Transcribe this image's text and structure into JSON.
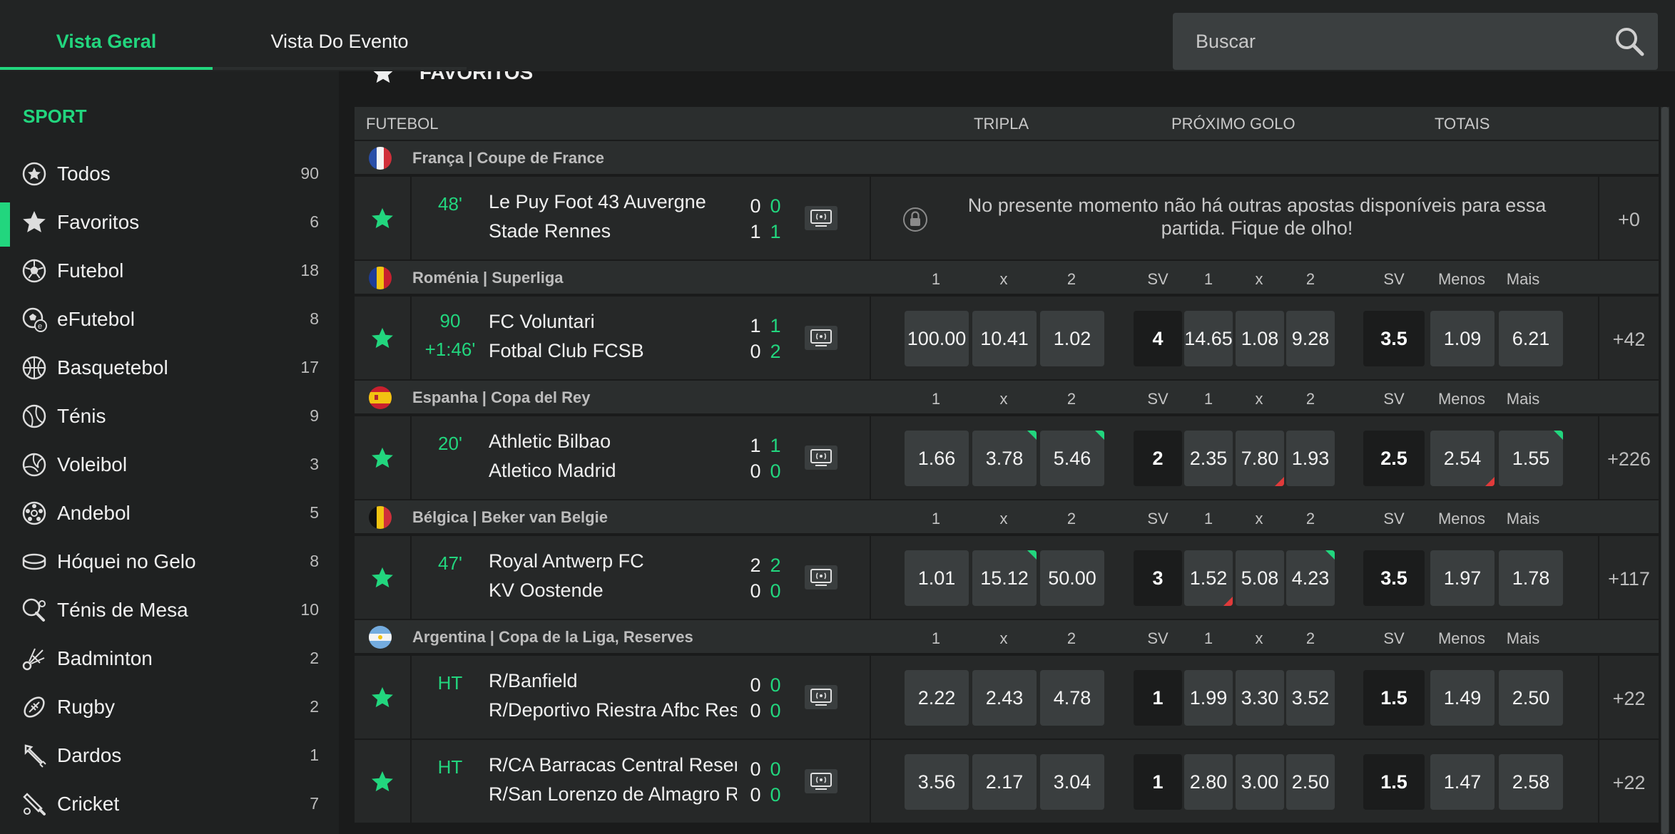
{
  "header": {
    "tabs": [
      {
        "label": "Vista Geral"
      },
      {
        "label": "Vista Do Evento"
      }
    ],
    "search_placeholder": "Buscar"
  },
  "sidebar": {
    "title": "SPORT",
    "items": [
      {
        "label": "Todos",
        "count": "90",
        "icon": "all-sports-icon"
      },
      {
        "label": "Favoritos",
        "count": "6",
        "icon": "star-icon"
      },
      {
        "label": "Futebol",
        "count": "18",
        "icon": "soccer-ball-icon"
      },
      {
        "label": "eFutebol",
        "count": "8",
        "icon": "esoccer-icon"
      },
      {
        "label": "Basquetebol",
        "count": "17",
        "icon": "basketball-icon"
      },
      {
        "label": "Ténis",
        "count": "9",
        "icon": "tennis-ball-icon"
      },
      {
        "label": "Voleibol",
        "count": "3",
        "icon": "volleyball-icon"
      },
      {
        "label": "Andebol",
        "count": "5",
        "icon": "handball-icon"
      },
      {
        "label": "Hóquei no Gelo",
        "count": "8",
        "icon": "ice-hockey-puck-icon"
      },
      {
        "label": "Ténis de Mesa",
        "count": "10",
        "icon": "table-tennis-icon"
      },
      {
        "label": "Badminton",
        "count": "2",
        "icon": "shuttlecock-icon"
      },
      {
        "label": "Rugby",
        "count": "2",
        "icon": "rugby-ball-icon"
      },
      {
        "label": "Dardos",
        "count": "1",
        "icon": "darts-icon"
      },
      {
        "label": "Cricket",
        "count": "7",
        "icon": "cricket-bat-icon"
      }
    ]
  },
  "favorites_header": "FAVORITOS",
  "columns": {
    "sport": "FUTEBOL",
    "tripla": "TRIPLA",
    "proximo": "PRÓXIMO GOLO",
    "totais": "TOTAIS"
  },
  "market_labels": {
    "one": "1",
    "x": "x",
    "two": "2",
    "sv": "SV",
    "menos": "Menos",
    "mais": "Mais"
  },
  "leagues": [
    {
      "name": "França | Coupe de France"
    },
    {
      "name": "Roménia | Superliga"
    },
    {
      "name": "Espanha | Copa del Rey"
    },
    {
      "name": "Bélgica | Beker van Belgie"
    },
    {
      "name": "Argentina | Copa de la Liga, Reserves"
    }
  ],
  "matches": [
    {
      "time": "48'",
      "time2": "",
      "home": "Le Puy Foot 43 Auvergne",
      "away": "Stade Rennes",
      "h1": "0",
      "h2": "0",
      "a1": "1",
      "a2": "1",
      "more": "+0",
      "no_bets": "No presente momento não há outras apostas disponíveis para essa partida. Fique de olho!"
    },
    {
      "time": "90",
      "time2": "+1:46'",
      "home": "FC Voluntari",
      "away": "Fotbal Club FCSB",
      "h1": "1",
      "h2": "1",
      "a1": "0",
      "a2": "2",
      "more": "+42",
      "tripla": [
        "100.00",
        "10.41",
        "1.02"
      ],
      "ng_sv": "4",
      "ng": [
        "14.65",
        "1.08",
        "9.28"
      ],
      "tot_sv": "3.5",
      "tot": [
        "1.09",
        "6.21"
      ]
    },
    {
      "time": "20'",
      "time2": "",
      "home": "Athletic Bilbao",
      "away": "Atletico Madrid",
      "h1": "1",
      "h2": "1",
      "a1": "0",
      "a2": "0",
      "more": "+226",
      "tripla": [
        "1.66",
        "3.78",
        "5.46"
      ],
      "ng_sv": "2",
      "ng": [
        "2.35",
        "7.80",
        "1.93"
      ],
      "tot_sv": "2.5",
      "tot": [
        "2.54",
        "1.55"
      ]
    },
    {
      "time": "47'",
      "time2": "",
      "home": "Royal Antwerp FC",
      "away": "KV Oostende",
      "h1": "2",
      "h2": "2",
      "a1": "0",
      "a2": "0",
      "more": "+117",
      "tripla": [
        "1.01",
        "15.12",
        "50.00"
      ],
      "ng_sv": "3",
      "ng": [
        "1.52",
        "5.08",
        "4.23"
      ],
      "tot_sv": "3.5",
      "tot": [
        "1.97",
        "1.78"
      ]
    },
    {
      "time": "HT",
      "time2": "",
      "home": "R/Banfield",
      "away": "R/Deportivo Riestra Afbc Reserves",
      "h1": "0",
      "h2": "0",
      "a1": "0",
      "a2": "0",
      "more": "+22",
      "tripla": [
        "2.22",
        "2.43",
        "4.78"
      ],
      "ng_sv": "1",
      "ng": [
        "1.99",
        "3.30",
        "3.52"
      ],
      "tot_sv": "1.5",
      "tot": [
        "1.49",
        "2.50"
      ]
    },
    {
      "time": "HT",
      "time2": "",
      "home": "R/CA Barracas Central Reserves",
      "away": "R/San Lorenzo de Almagro Reserves",
      "h1": "0",
      "h2": "0",
      "a1": "0",
      "a2": "0",
      "more": "+22",
      "tripla": [
        "3.56",
        "2.17",
        "3.04"
      ],
      "ng_sv": "1",
      "ng": [
        "2.80",
        "3.00",
        "2.50"
      ],
      "tot_sv": "1.5",
      "tot": [
        "1.47",
        "2.58"
      ]
    }
  ],
  "colors": {
    "accent": "#22d67e",
    "odd_bg": "#3a3e3f",
    "up": "#22d67e",
    "down": "#e03a3a"
  }
}
